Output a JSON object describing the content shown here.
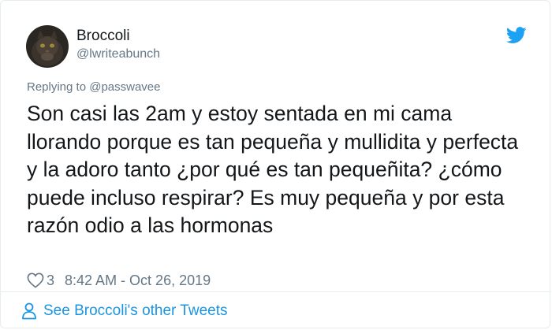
{
  "author": {
    "name": "Broccoli",
    "handle": "@lwriteabunch"
  },
  "reply": {
    "prefix": "Replying to ",
    "mention": "@passwavee"
  },
  "tweet": {
    "text": "Son casi las 2am y estoy sentada en mi cama llorando porque es tan pequeña y mullidita y perfecta y la adoro tanto ¿por qué es tan pequeñita? ¿cómo puede incluso respirar? Es muy pequeña y por esta razón odio a las hormonas"
  },
  "meta": {
    "likes": "3",
    "timestamp": "8:42 AM - Oct 26, 2019"
  },
  "footer": {
    "see_more": "See Broccoli's other Tweets"
  },
  "icons": {
    "brand": "twitter-bird-icon",
    "like": "heart-icon",
    "profile": "person-icon"
  },
  "colors": {
    "brand_blue": "#1da1f2",
    "link_blue": "#1b95e0",
    "secondary_text": "#657786",
    "primary_text": "#14171a",
    "border": "#e6ecf0"
  }
}
